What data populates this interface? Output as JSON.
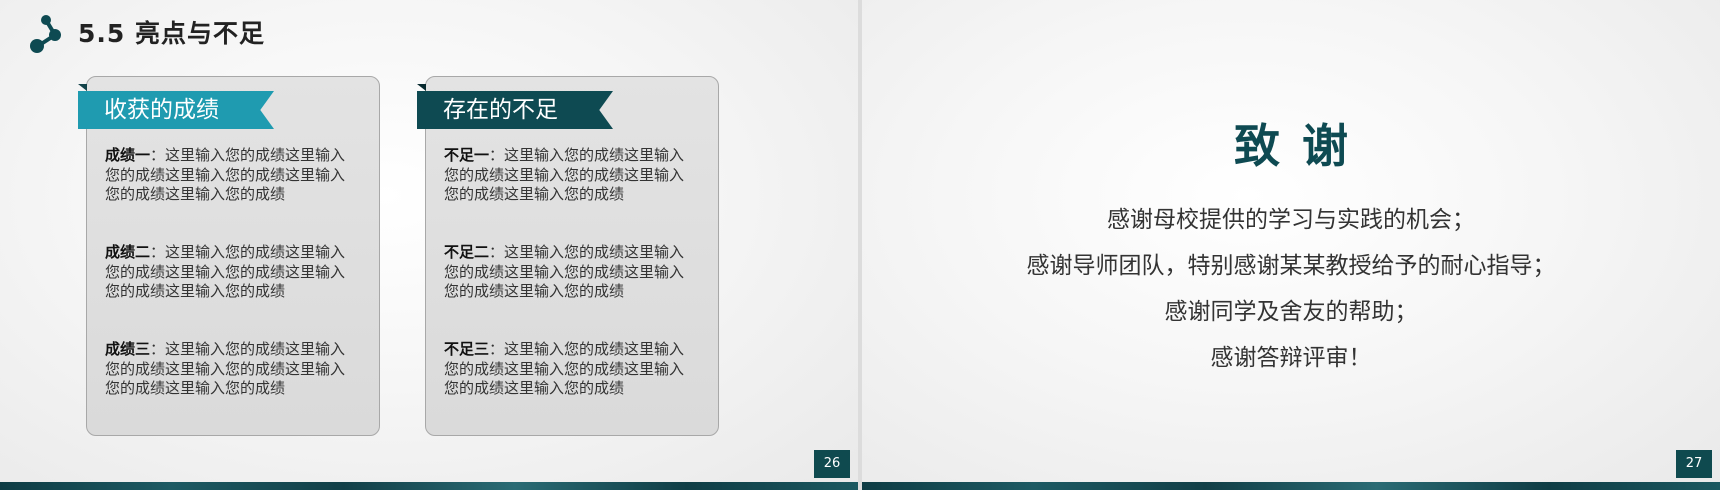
{
  "left_slide": {
    "title": "5.5 亮点与不足",
    "page_number": "26",
    "gains": {
      "heading": "收获的成绩",
      "items": [
        {
          "label": "成绩一",
          "text": "：这里输入您的成绩这里输入您的成绩这里输入您的成绩这里输入您的成绩这里输入您的成绩"
        },
        {
          "label": "成绩二",
          "text": "：这里输入您的成绩这里输入您的成绩这里输入您的成绩这里输入您的成绩这里输入您的成绩"
        },
        {
          "label": "成绩三",
          "text": "：这里输入您的成绩这里输入您的成绩这里输入您的成绩这里输入您的成绩这里输入您的成绩"
        }
      ]
    },
    "lacks": {
      "heading": "存在的不足",
      "items": [
        {
          "label": "不足一",
          "text": "：这里输入您的成绩这里输入您的成绩这里输入您的成绩这里输入您的成绩这里输入您的成绩"
        },
        {
          "label": "不足二",
          "text": "：这里输入您的成绩这里输入您的成绩这里输入您的成绩这里输入您的成绩这里输入您的成绩"
        },
        {
          "label": "不足三",
          "text": "：这里输入您的成绩这里输入您的成绩这里输入您的成绩这里输入您的成绩这里输入您的成绩"
        }
      ]
    }
  },
  "right_slide": {
    "title": "致谢",
    "page_number": "27",
    "lines": [
      "感谢母校提供的学习与实践的机会；",
      "感谢导师团队，特别感谢某某教授给予的耐心指导；",
      "感谢同学及舍友的帮助；",
      "感谢答辩评审！"
    ]
  },
  "colors": {
    "accent_teal": "#1f9bb0",
    "accent_dark": "#0e4a52"
  }
}
